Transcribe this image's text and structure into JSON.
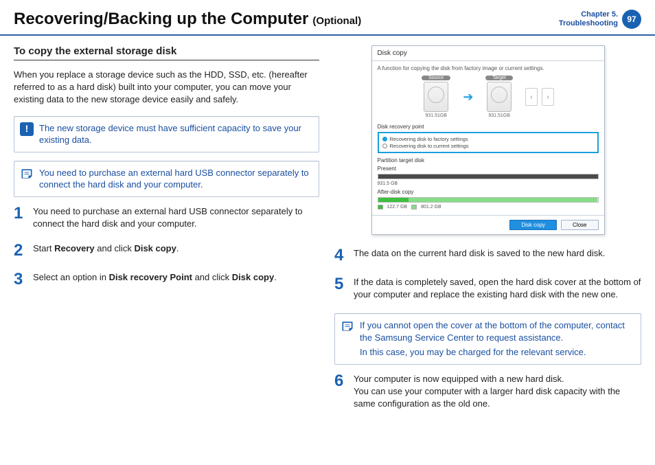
{
  "header": {
    "title": "Recovering/Backing up the Computer",
    "suffix": "(Optional)",
    "chapter_line1": "Chapter 5.",
    "chapter_line2": "Troubleshooting",
    "page_number": "97"
  },
  "left": {
    "subtitle": "To copy the external storage disk",
    "intro": "When you replace a storage device such as the HDD, SSD, etc. (hereafter referred to as a hard disk) built into your computer, you can move your existing data to the new storage device easily and safely.",
    "callout_important": "The new storage device must have sufficient capacity to save your existing data.",
    "callout_note": "You need to purchase an external hard USB connector separately to connect the hard disk and your computer.",
    "step1": "You need to purchase an external hard USB connector separately to connect the hard disk and your computer.",
    "step2_pre": "Start ",
    "step2_b1": "Recovery",
    "step2_mid": " and click ",
    "step2_b2": "Disk copy",
    "step2_post": ".",
    "step3_pre": "Select an option in ",
    "step3_b1": "Disk recovery Point",
    "step3_mid": " and click ",
    "step3_b2": "Disk copy",
    "step3_post": "."
  },
  "right": {
    "step4": "The data on the current hard disk is saved to the new hard disk.",
    "step5": "If the data is completely saved, open the hard disk cover at the bottom of your computer and replace the existing hard disk with the new one.",
    "callout_note_line1": "If you cannot open the cover at the bottom of the computer, contact the Samsung Service Center to request assistance.",
    "callout_note_line2": "In this case, you may be charged for the relevant service.",
    "step6_line1": "Your computer is now equipped with a new hard disk.",
    "step6_line2": "You can use your computer with a larger hard disk capacity with the same configuration as the old one."
  },
  "shot": {
    "window_title": "Disk copy",
    "subtitle": "A function for copying the disk from factory image or current settings.",
    "source_label": "Source",
    "target_label": "Target",
    "drive_size": "931.51GB",
    "recovery_section": "Disk recovery point",
    "radio1": "Recovering disk to factory settings",
    "radio2": "Recovering disk to current settings",
    "partition_section": "Partition target disk",
    "present_label": "Present",
    "present_size": "931.5 GB",
    "after_label": "After-disk copy",
    "after_left": "122.7 GB",
    "after_right": "801.2 GB",
    "btn_primary": "Disk copy",
    "btn_close": "Close"
  }
}
